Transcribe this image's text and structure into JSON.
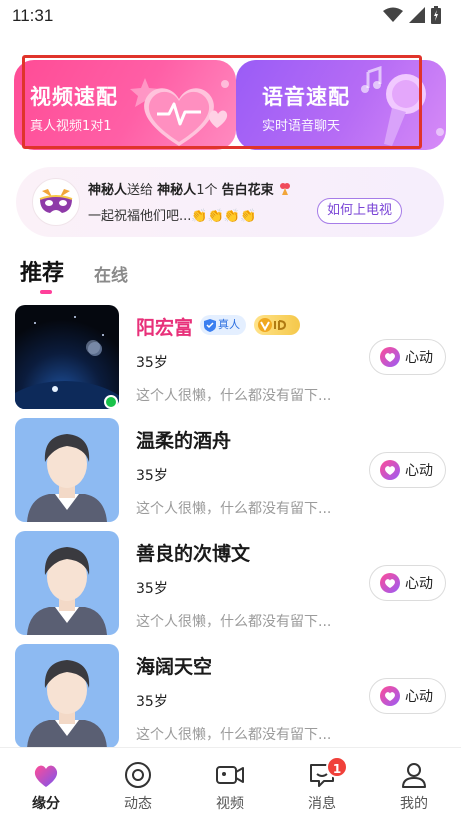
{
  "status_bar": {
    "time": "11:31"
  },
  "quick_match": {
    "video": {
      "title": "视频速配",
      "subtitle": "真人视频1对1"
    },
    "voice": {
      "title": "语音速配",
      "subtitle": "实时语音聊天"
    }
  },
  "gift_banner": {
    "sender": "神秘人",
    "sent_to": "送给",
    "receiver": "神秘人",
    "count": "1个",
    "gift": "告白花束",
    "message": "一起祝福他们吧...👏👏👏👏",
    "button": "如何上电视"
  },
  "tabs": [
    {
      "label": "推荐",
      "active": true
    },
    {
      "label": "在线",
      "active": false
    }
  ],
  "users": [
    {
      "name": "阳宏富",
      "age": "35岁",
      "bio": "这个人很懒，什么都没有留下...",
      "real_badge": "真人",
      "vip": true,
      "online": true,
      "avatar": "space-photo",
      "action": "心动"
    },
    {
      "name": "温柔的酒舟",
      "age": "35岁",
      "bio": "这个人很懒，什么都没有留下...",
      "vip": false,
      "online": false,
      "avatar": "default-male-avatar",
      "action": "心动"
    },
    {
      "name": "善良的次博文",
      "age": "35岁",
      "bio": "这个人很懒，什么都没有留下...",
      "vip": false,
      "online": false,
      "avatar": "default-male-avatar",
      "action": "心动"
    },
    {
      "name": "海阔天空",
      "age": "35岁",
      "bio": "这个人很懒，什么都没有留下...",
      "vip": false,
      "online": false,
      "avatar": "default-male-avatar",
      "action": "心动"
    }
  ],
  "bottom_nav": [
    {
      "label": "缘分",
      "icon": "heart-icon",
      "active": true
    },
    {
      "label": "动态",
      "icon": "target-icon",
      "active": false
    },
    {
      "label": "视频",
      "icon": "video-camera-icon",
      "active": false
    },
    {
      "label": "消息",
      "icon": "message-icon",
      "active": false,
      "badge": "1"
    },
    {
      "label": "我的",
      "icon": "person-icon",
      "active": false
    }
  ],
  "colors": {
    "accent_pink": "#ff3f9a",
    "accent_purple": "#9a5cf6",
    "online": "#19c24a",
    "badge_red": "#f0403a"
  }
}
